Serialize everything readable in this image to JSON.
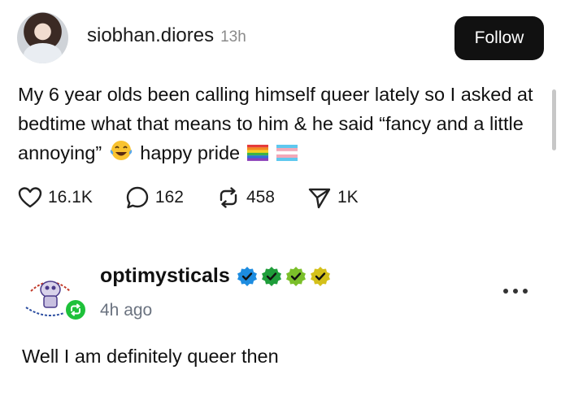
{
  "post1": {
    "username": "siobhan.diores",
    "time_ago": "13h",
    "follow_label": "Follow",
    "text_part1": "My 6 year olds been calling himself queer lately so I asked at bedtime what that means to him & he said “fancy and a little annoying”",
    "text_part2": "happy pride",
    "emojis": [
      "laughing-tears-emoji",
      "rainbow-flag-emoji",
      "transgender-flag-emoji"
    ],
    "actions": {
      "likes": "16.1K",
      "replies": "162",
      "reposts": "458",
      "shares": "1K"
    }
  },
  "post2": {
    "username": "optimysticals",
    "time_ago": "4h ago",
    "badge_colors": [
      "#1d8ce0",
      "#1f9d3a",
      "#7bbf2a",
      "#d4c01a"
    ],
    "text": "Well I am definitely queer then"
  },
  "colors": {
    "follow_bg": "#111111",
    "reblog_green": "#1ec13a",
    "muted_text": "#8a8a8a"
  }
}
